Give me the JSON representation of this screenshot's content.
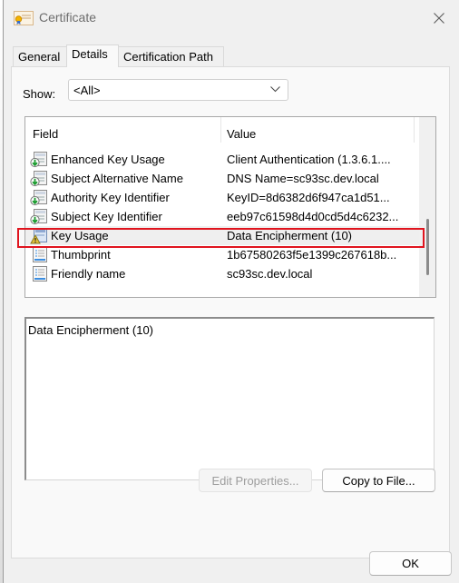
{
  "window": {
    "title": "Certificate",
    "icon": "certificate-icon",
    "close_icon": "close-icon"
  },
  "tabs": [
    {
      "label": "General",
      "active": false
    },
    {
      "label": "Details",
      "active": true
    },
    {
      "label": "Certification Path",
      "active": false
    }
  ],
  "show_filter": {
    "label": "Show:",
    "selected": "<All>"
  },
  "fields_list": {
    "columns": [
      "Field",
      "Value"
    ],
    "rows": [
      {
        "field": "Enhanced Key Usage",
        "value": "Client Authentication (1.3.6.1....",
        "icon": "extension-icon",
        "selected": false
      },
      {
        "field": "Subject Alternative Name",
        "value": "DNS Name=sc93sc.dev.local",
        "icon": "extension-icon",
        "selected": false
      },
      {
        "field": "Authority Key Identifier",
        "value": "KeyID=8d6382d6f947ca1d51...",
        "icon": "extension-icon",
        "selected": false
      },
      {
        "field": "Subject Key Identifier",
        "value": "eeb97c61598d4d0cd5d4c6232...",
        "icon": "extension-icon",
        "selected": false
      },
      {
        "field": "Key Usage",
        "value": "Data Encipherment (10)",
        "icon": "critical-extension-icon",
        "selected": true
      },
      {
        "field": "Thumbprint",
        "value": "1b67580263f5e1399c267618b...",
        "icon": "property-icon",
        "selected": false
      },
      {
        "field": "Friendly name",
        "value": "sc93sc.dev.local",
        "icon": "property-icon",
        "selected": false
      }
    ]
  },
  "detail_text": "Data Encipherment (10)",
  "buttons": {
    "edit_properties": "Edit Properties...",
    "copy_to_file": "Copy to File...",
    "ok": "OK"
  },
  "colors": {
    "highlight_border": "#e0141e",
    "selected_row": "#efefef"
  }
}
